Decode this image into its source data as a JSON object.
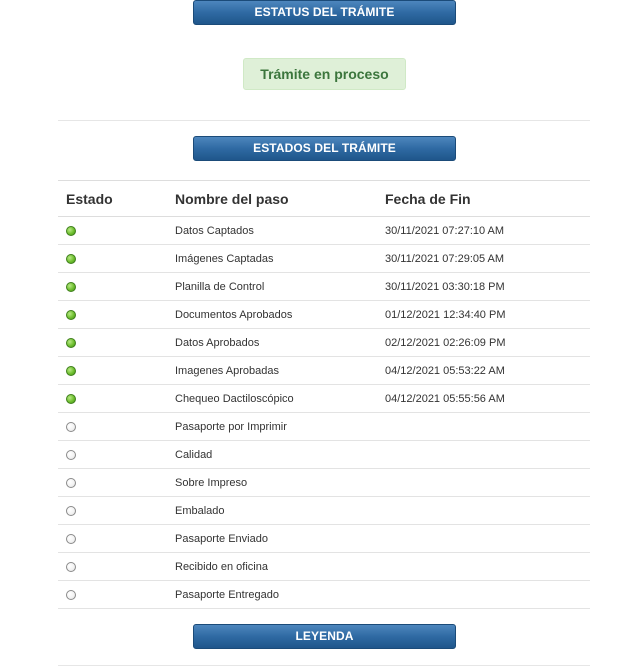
{
  "buttons": {
    "estatus": "ESTATUS DEL TRÁMITE",
    "estados": "ESTADOS DEL TRÁMITE",
    "leyenda": "LEYENDA"
  },
  "status": {
    "text": "Trámite en proceso",
    "color": "#3c763d",
    "background": "#dff0d8"
  },
  "table": {
    "headers": [
      "Estado",
      "Nombre del paso",
      "Fecha de Fin"
    ],
    "rows": [
      {
        "state": "done",
        "icon": "green-dot-icon",
        "name": "Datos Captados",
        "date": "30/11/2021 07:27:10 AM"
      },
      {
        "state": "done",
        "icon": "green-dot-icon",
        "name": "Imágenes Captadas",
        "date": "30/11/2021 07:29:05 AM"
      },
      {
        "state": "done",
        "icon": "green-dot-icon",
        "name": "Planilla de Control",
        "date": "30/11/2021 03:30:18 PM"
      },
      {
        "state": "done",
        "icon": "green-dot-icon",
        "name": "Documentos Aprobados",
        "date": "01/12/2021 12:34:40 PM"
      },
      {
        "state": "done",
        "icon": "green-dot-icon",
        "name": "Datos Aprobados",
        "date": "02/12/2021 02:26:09 PM"
      },
      {
        "state": "done",
        "icon": "green-dot-icon",
        "name": "Imagenes Aprobadas",
        "date": "04/12/2021 05:53:22 AM"
      },
      {
        "state": "done",
        "icon": "green-dot-icon",
        "name": "Chequeo Dactiloscópico",
        "date": "04/12/2021 05:55:56 AM"
      },
      {
        "state": "pending",
        "icon": "empty-circle-icon",
        "name": "Pasaporte por Imprimir",
        "date": ""
      },
      {
        "state": "pending",
        "icon": "empty-circle-icon",
        "name": "Calidad",
        "date": ""
      },
      {
        "state": "pending",
        "icon": "empty-circle-icon",
        "name": "Sobre Impreso",
        "date": ""
      },
      {
        "state": "pending",
        "icon": "empty-circle-icon",
        "name": "Embalado",
        "date": ""
      },
      {
        "state": "pending",
        "icon": "empty-circle-icon",
        "name": "Pasaporte Enviado",
        "date": ""
      },
      {
        "state": "pending",
        "icon": "empty-circle-icon",
        "name": "Recibido en oficina",
        "date": ""
      },
      {
        "state": "pending",
        "icon": "empty-circle-icon",
        "name": "Pasaporte Entregado",
        "date": ""
      }
    ]
  },
  "colors": {
    "button": "#2f6aa3",
    "done_dot": "#6fbf2f"
  }
}
